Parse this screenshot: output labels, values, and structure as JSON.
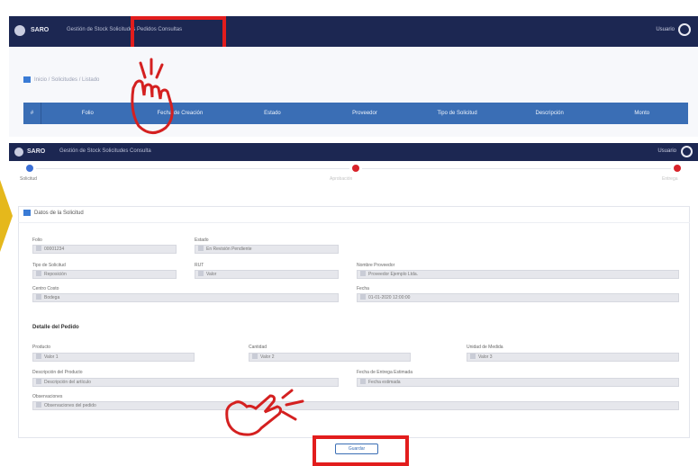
{
  "background_window": {
    "brand": "SARO",
    "menu": "Gestión de Stock   Solicitudes   Pedidos   Consultas",
    "user": "Usuario",
    "breadcrumb": "Inicio   /   Solicitudes   /   Listado",
    "grid_columns": [
      "Folio",
      "Fecha de Creación",
      "Estado",
      "Proveedor",
      "Tipo de Solicitud",
      "Descripción",
      "Monto"
    ]
  },
  "dialog": {
    "brand": "SARO",
    "menu": "Gestión de Stock   Solicitudes   Consulta",
    "user": "Usuario",
    "steps": [
      "Solicitud",
      "Aprobación",
      "Entrega"
    ],
    "card_title": "Datos de la Solicitud",
    "fields": {
      "f1": {
        "label": "Folio",
        "value": "00001234"
      },
      "f2": {
        "label": "Estado",
        "value": "En Revisión Pendiente"
      },
      "f3": {
        "label": "Tipo de Solicitud",
        "value": "Reposición"
      },
      "f4": {
        "label": "RUT",
        "value": "Valor"
      },
      "f5": {
        "label": "Nombre Proveedor",
        "value": "Proveedor Ejemplo Ltda."
      },
      "f6": {
        "label": "Centro Costo",
        "value": "Bodega"
      },
      "f7": {
        "label": "Fecha",
        "value": "01-01-2020 12:00:00"
      }
    },
    "section_title": "Detalle del Pedido",
    "detail_fields": {
      "d1": {
        "label": "Producto",
        "value": "Valor 1"
      },
      "d2": {
        "label": "Cantidad",
        "value": "Valor 2"
      },
      "d3": {
        "label": "Unidad de Medida",
        "value": "Valor 3"
      },
      "d4": {
        "label": "Descripción del Producto",
        "value": "Descripción del artículo"
      },
      "d5": {
        "label": "Fecha de Entrega Estimada",
        "value": "Fecha estimada"
      },
      "d6": {
        "label": "Observaciones",
        "value": "Observaciones del pedido"
      }
    },
    "submit_label": "Guardar"
  },
  "colors": {
    "nav_bg": "#1c2752",
    "grid_header": "#3a6eb5",
    "highlight": "#e21d1d",
    "step_active": "#3b6fd6",
    "step_pending": "#d8232a",
    "arrow": "#e5b81c"
  },
  "icons": [
    "user-icon",
    "list-icon",
    "form-icon",
    "pointer-hand-icon",
    "arrow-right-icon"
  ]
}
